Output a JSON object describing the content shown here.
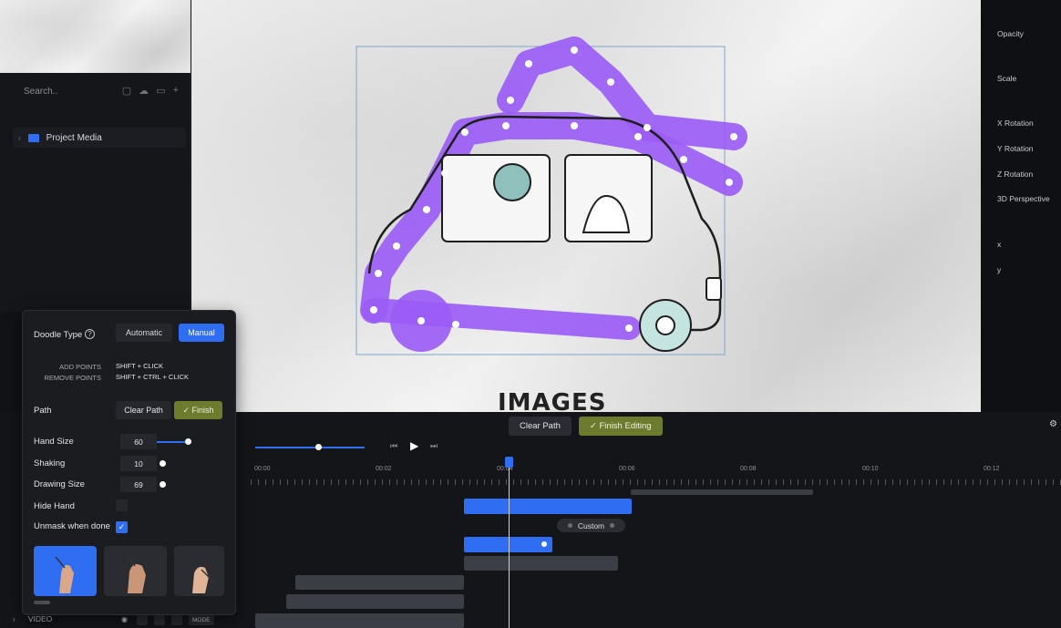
{
  "media": {
    "search_placeholder": "Search..",
    "folder_label": "Project Media"
  },
  "canvas": {
    "title_text": "IMAGES"
  },
  "properties": {
    "items": [
      "Opacity",
      "Scale",
      "X Rotation",
      "Y Rotation",
      "Z Rotation",
      "3D Perspective",
      "x",
      "y"
    ]
  },
  "canvas_actions": {
    "clear_path": "Clear Path",
    "finish_editing": "Finish Editing"
  },
  "timeline": {
    "ticks": [
      "00:00",
      "00:02",
      "00:04",
      "00:06",
      "00:08",
      "00:10",
      "00:12"
    ],
    "custom_label": "Custom",
    "track_video_label": "VIDEO",
    "mode_label": "MODE"
  },
  "doodle": {
    "type_label": "Doodle Type",
    "automatic": "Automatic",
    "manual": "Manual",
    "add_points_label": "ADD POINTS",
    "add_points_keys": "SHIFT + CLICK",
    "remove_points_label": "REMOVE POINTS",
    "remove_points_keys": "SHIFT + CTRL + CLICK",
    "path_label": "Path",
    "clear_path": "Clear Path",
    "finish": "Finish",
    "hand_size_label": "Hand Size",
    "hand_size_value": "60",
    "shaking_label": "Shaking",
    "shaking_value": "10",
    "drawing_size_label": "Drawing Size",
    "drawing_size_value": "69",
    "hide_hand_label": "Hide Hand",
    "unmask_label": "Unmask when done"
  },
  "colors": {
    "accent_blue": "#2f6df3",
    "doodle_purple": "#9b5cf6",
    "olive": "#6d7b2e"
  }
}
